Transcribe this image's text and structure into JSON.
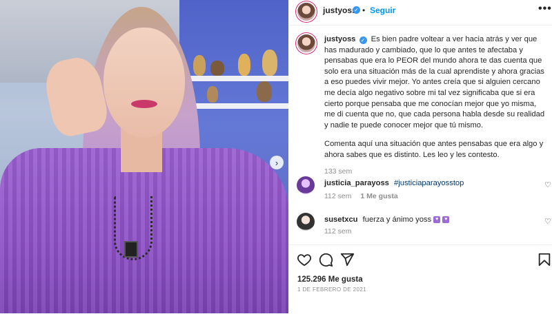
{
  "post": {
    "username": "justyoss",
    "follow_label": "Seguir",
    "more_label": "•••",
    "caption_username": "justyoss",
    "caption_p1": "Es bien padre voltear a ver hacia atrás y ver que has madurado y cambiado, que lo que antes te afectaba y pensabas que era lo PEOR del mundo ahora te das cuenta que solo era una situación más de la cual aprendiste y ahora gracias a eso puedes vivir mejor. Yo antes creía que si alguien cercano me decía algo negativo sobre mi tal vez significaba que si era cierto porque pensaba que me conocían mejor que yo misma, me di cuenta que no, que cada persona habla desde su realidad y nadie te puede conocer mejor que tú mismo.",
    "caption_p2": "Comenta aquí una situación que antes pensabas que era algo y ahora sabes que es distinto. Les leo y les contesto.",
    "caption_time": "133 sem",
    "likes": "125.296 Me gusta",
    "date": "1 DE FEBRERO DE 2021"
  },
  "comments": [
    {
      "username": "justicia_parayoss",
      "text": "#justiciaparayosstop",
      "time": "112 sem",
      "likes": "1 Me gusta"
    },
    {
      "username": "susetxcu",
      "text": "fuerza y ánimo yoss",
      "time": "112 sem"
    }
  ],
  "icons": {
    "verified": "verified-badge-icon",
    "like": "heart-icon",
    "comment": "comment-bubble-icon",
    "share": "paper-plane-icon",
    "save": "bookmark-icon",
    "next": "chevron-right-icon"
  },
  "colors": {
    "accent": "#0095f6",
    "verified": "#3897f0",
    "hashtag": "#00376b",
    "muted": "#8e8e8e"
  }
}
